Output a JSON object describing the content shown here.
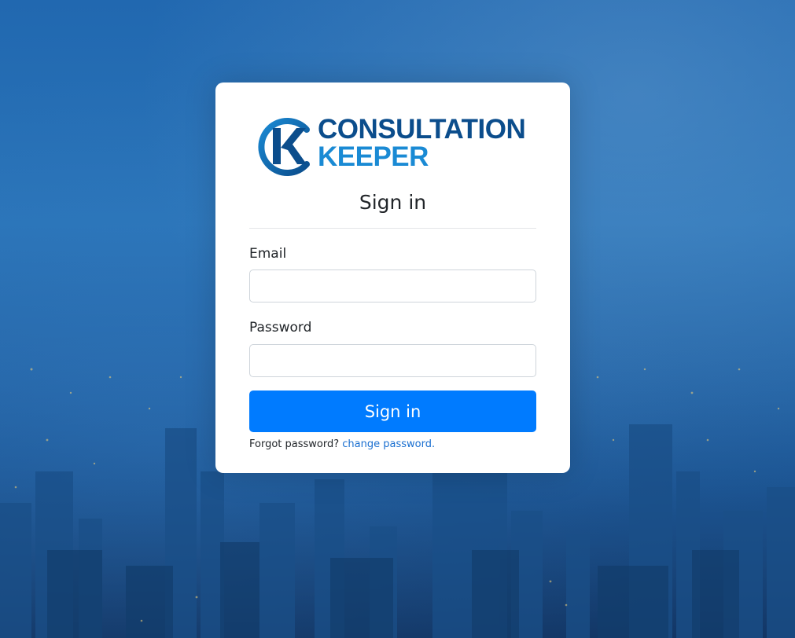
{
  "brand": {
    "name_line1": "CONSULTATION",
    "name_line2": "KEEPER",
    "color_dark": "#0b4d8c",
    "color_light": "#1a8ad4"
  },
  "form": {
    "title": "Sign in",
    "email_label": "Email",
    "email_value": "",
    "password_label": "Password",
    "password_value": "",
    "submit_label": "Sign in",
    "forgot_text": "Forgot password?",
    "forgot_link": "change password."
  },
  "colors": {
    "primary_button": "#007bff",
    "link": "#1a6fd0",
    "background": "#1d62a8"
  }
}
